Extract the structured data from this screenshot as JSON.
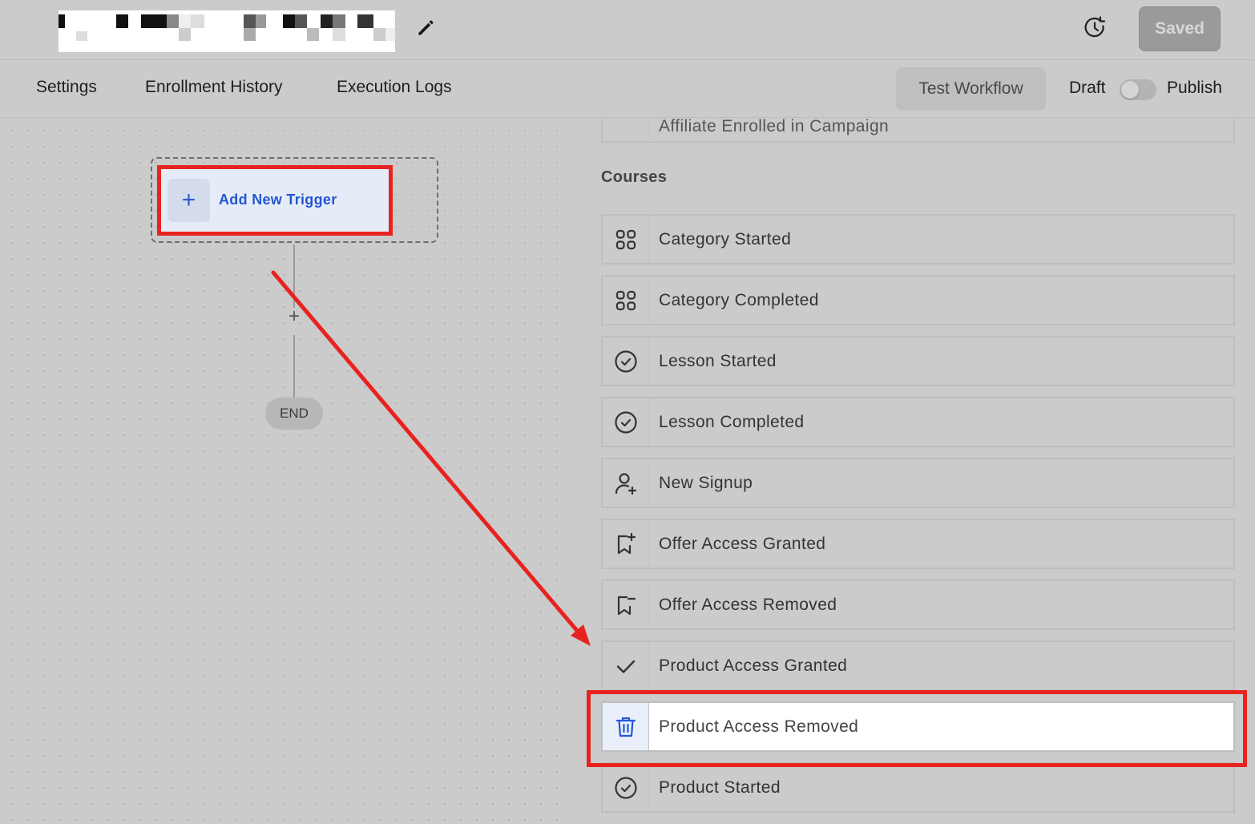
{
  "nav": {
    "tabs": [
      "Settings",
      "Enrollment History",
      "Execution Logs"
    ],
    "test_workflow": "Test Workflow",
    "draft": "Draft",
    "publish": "Publish"
  },
  "header": {
    "saved": "Saved",
    "edit_icon": "pencil-icon",
    "history_icon": "history-icon"
  },
  "canvas": {
    "add_trigger_label": "Add New Trigger",
    "end_label": "END"
  },
  "panel": {
    "partial_item": "Affiliate Enrolled in Campaign",
    "section_title": "Courses",
    "items": [
      {
        "label": "Category Started",
        "icon": "grid-icon"
      },
      {
        "label": "Category Completed",
        "icon": "grid-icon"
      },
      {
        "label": "Lesson Started",
        "icon": "check-circle-icon"
      },
      {
        "label": "Lesson Completed",
        "icon": "check-circle-icon"
      },
      {
        "label": "New Signup",
        "icon": "user-plus-icon"
      },
      {
        "label": "Offer Access Granted",
        "icon": "bookmark-plus-icon"
      },
      {
        "label": "Offer Access Removed",
        "icon": "bookmark-minus-icon"
      },
      {
        "label": "Product Access Granted",
        "icon": "check-icon"
      },
      {
        "label": "Product Access Removed",
        "icon": "trash-icon"
      },
      {
        "label": "Product Started",
        "icon": "check-circle-icon"
      }
    ]
  },
  "colors": {
    "annotation_red": "#e8231f",
    "accent_blue": "#2456d6"
  }
}
